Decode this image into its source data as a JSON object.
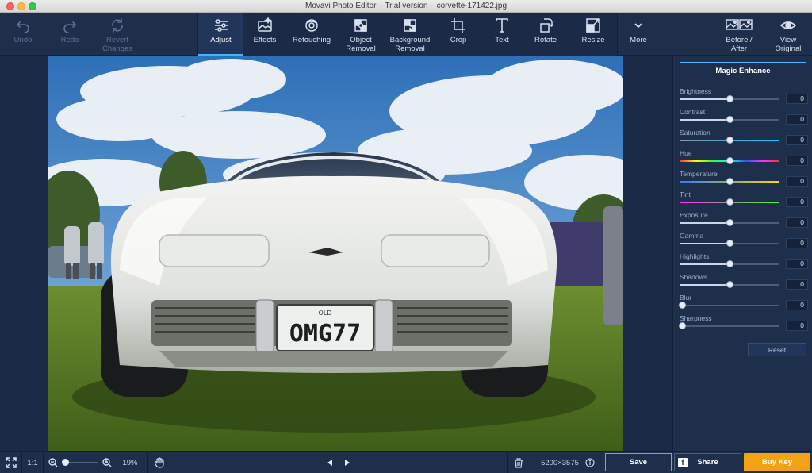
{
  "window": {
    "title": "Movavi Photo Editor – Trial version – corvette-171422.jpg"
  },
  "toolbar": {
    "undo": "Undo",
    "redo": "Redo",
    "revert_line1": "Revert",
    "revert_line2": "Changes",
    "tools": {
      "adjust": "Adjust",
      "effects": "Effects",
      "retouching": "Retouching",
      "object_removal_line1": "Object",
      "object_removal_line2": "Removal",
      "background_removal_line1": "Background",
      "background_removal_line2": "Removal",
      "crop": "Crop",
      "text": "Text",
      "rotate": "Rotate",
      "resize": "Resize",
      "more": "More"
    },
    "before_after_line1": "Before /",
    "before_after_line2": "After",
    "view_original_line1": "View",
    "view_original_line2": "Original"
  },
  "photo": {
    "plate_small": "OLD",
    "plate": "OMG77"
  },
  "panel": {
    "magic_enhance": "Magic Enhance",
    "reset": "Reset",
    "sliders": [
      {
        "label": "Brightness",
        "value": "0",
        "level": 0.5
      },
      {
        "label": "Contrast",
        "value": "0",
        "level": 0.5
      },
      {
        "label": "Saturation",
        "value": "0",
        "level": 0.5
      },
      {
        "label": "Hue",
        "value": "0",
        "level": 0.5
      },
      {
        "label": "Temperature",
        "value": "0",
        "level": 0.5
      },
      {
        "label": "Tint",
        "value": "0",
        "level": 0.5
      },
      {
        "label": "Exposure",
        "value": "0",
        "level": 0.5
      },
      {
        "label": "Gamma",
        "value": "0",
        "level": 0.5
      },
      {
        "label": "Highlights",
        "value": "0",
        "level": 0.5
      },
      {
        "label": "Shadows",
        "value": "0",
        "level": 0.5
      },
      {
        "label": "Blur",
        "value": "0",
        "level": 0.0
      },
      {
        "label": "Sharpness",
        "value": "0",
        "level": 0.0
      }
    ]
  },
  "bottombar": {
    "one_to_one": "1:1",
    "zoom": "19%",
    "zoom_level": 0.0,
    "dimensions": "5200×3575",
    "save": "Save",
    "share": "Share",
    "share_icon_glyph": "f",
    "buy": "Buy Key"
  },
  "colors": {
    "accent_blue": "#3fb6ff",
    "save_border": "#2fd3a8",
    "buy_orange": "#f2a313"
  }
}
